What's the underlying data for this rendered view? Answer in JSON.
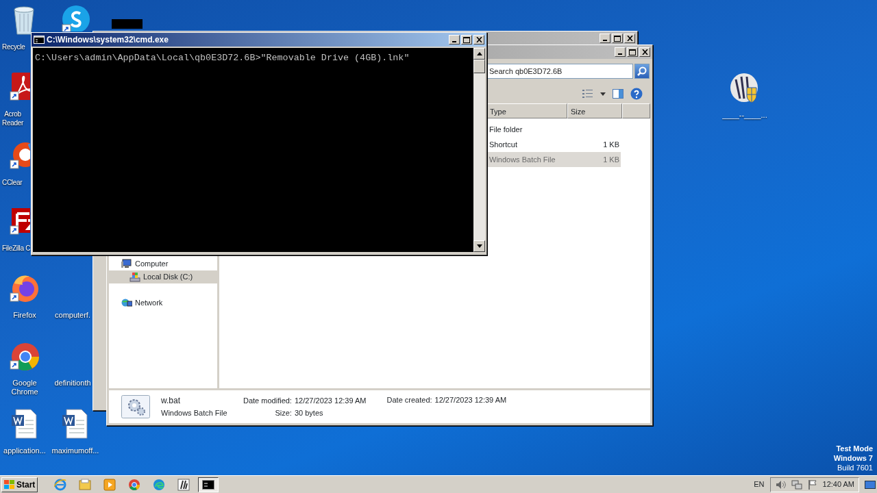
{
  "desktop_icons": [
    {
      "kind": "recycle",
      "lines": [
        "Recycle"
      ]
    },
    {
      "kind": "skype"
    },
    {
      "kind": "acrobat",
      "lines": [
        "Acrob",
        "Reader"
      ]
    },
    {
      "kind": "ccleaner",
      "lines": [
        "CClear"
      ]
    },
    {
      "kind": "filezilla",
      "lines": [
        "FileZilla C"
      ]
    },
    {
      "kind": "firefox",
      "lines": [
        "Firefox"
      ]
    },
    {
      "kind": "blank",
      "lines": [
        "computerf."
      ]
    },
    {
      "kind": "chrome",
      "lines": [
        "Google",
        "Chrome"
      ]
    },
    {
      "kind": "blank",
      "lines": [
        "definitionth"
      ]
    },
    {
      "kind": "word",
      "lines": [
        "application..."
      ]
    },
    {
      "kind": "word",
      "lines": [
        "maximumoff..."
      ]
    },
    {
      "kind": "shield",
      "lines": [
        "____--____..."
      ]
    }
  ],
  "system_notice": [
    "Test Mode",
    "Windows 7",
    "Build 7601"
  ],
  "explorer": {
    "search": {
      "placeholder": "Search qb0E3D72.6B"
    },
    "columns": [
      "Type",
      "Size"
    ],
    "rows": [
      {
        "type": "File folder",
        "selected": false
      },
      {
        "type": "Shortcut",
        "size": "1 KB",
        "selected": false
      },
      {
        "type": "Windows Batch File",
        "size": "1 KB",
        "selected": true
      }
    ],
    "nav": [
      {
        "kind": "computer",
        "label": "Computer",
        "selected": false,
        "children": [
          {
            "kind": "disk",
            "label": "Local Disk (C:)",
            "selected": true
          }
        ]
      },
      {
        "kind": "network",
        "label": "Network",
        "selected": false
      }
    ],
    "details": {
      "name": "w.bat",
      "type": "Windows Batch File",
      "fields": [
        {
          "label": "Date modified:",
          "value": "12/27/2023 12:39 AM"
        },
        {
          "label": "Size:",
          "value": "30 bytes"
        },
        {
          "label": "Date created:",
          "value": "12/27/2023 12:39 AM"
        }
      ]
    }
  },
  "cmd": {
    "title": "C:\\Windows\\system32\\cmd.exe",
    "lines": [
      "C:\\Users\\admin\\AppData\\Local\\qb0E3D72.6B>\"Removable Drive (4GB).lnk\""
    ]
  },
  "taskbar": {
    "start": "Start",
    "apps": [
      {
        "kind": "ie",
        "selected": false
      },
      {
        "kind": "folder",
        "selected": false
      },
      {
        "kind": "media",
        "selected": false
      },
      {
        "kind": "chrome",
        "selected": false
      },
      {
        "kind": "edge",
        "selected": false
      },
      {
        "kind": "app",
        "selected": false
      },
      {
        "kind": "cmd",
        "selected": true
      }
    ],
    "language": "EN",
    "time": "12:40 AM"
  }
}
